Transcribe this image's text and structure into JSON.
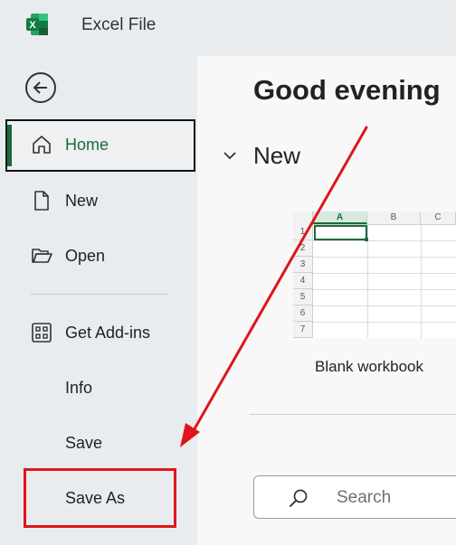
{
  "app": {
    "title": "Excel File",
    "logo_letter": "X"
  },
  "colors": {
    "accent": "#1c6b3c",
    "annotation": "#e0141b"
  },
  "sidebar": {
    "items": [
      {
        "label": "Home",
        "icon": "home-icon",
        "active": true
      },
      {
        "label": "New",
        "icon": "new-document-icon"
      },
      {
        "label": "Open",
        "icon": "folder-open-icon"
      },
      {
        "label": "Get Add-ins",
        "icon": "add-ins-grid-icon"
      },
      {
        "label": "Info"
      },
      {
        "label": "Save"
      },
      {
        "label": "Save As",
        "highlighted": true
      }
    ]
  },
  "main": {
    "greeting": "Good evening",
    "section_title": "New",
    "template": {
      "label": "Blank workbook",
      "columns": [
        "A",
        "B",
        "C"
      ],
      "rows": [
        "1",
        "2",
        "3",
        "4",
        "5",
        "6",
        "7"
      ]
    },
    "search": {
      "placeholder": "Search"
    }
  }
}
